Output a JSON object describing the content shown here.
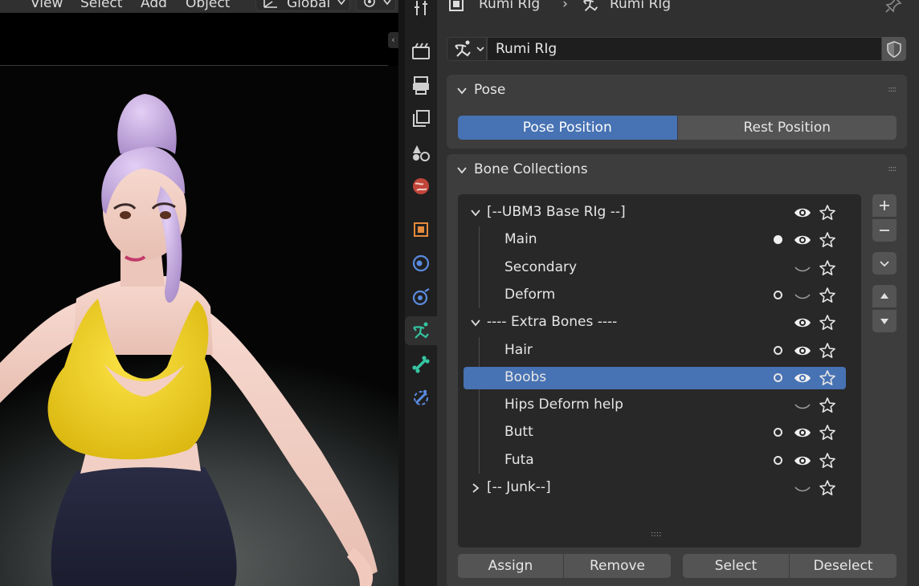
{
  "viewport": {
    "menu": [
      "View",
      "Select",
      "Add",
      "Object"
    ],
    "orientation": "Global"
  },
  "tabs": [
    {
      "icon": "tool-icon"
    },
    {
      "icon": "render-icon"
    },
    {
      "icon": "output-icon"
    },
    {
      "icon": "view-layer-icon"
    },
    {
      "icon": "scene-icon"
    },
    {
      "icon": "world-icon"
    },
    {
      "icon": "object-icon"
    },
    {
      "icon": "modifiers-icon"
    },
    {
      "icon": "physics-icon"
    },
    {
      "icon": "armature-data-icon",
      "active": true
    },
    {
      "icon": "bone-icon"
    },
    {
      "icon": "bone-constraints-icon"
    }
  ],
  "breadcrumb": {
    "object": "Rumi RIg",
    "data": "Rumi RIg"
  },
  "datablock": {
    "name": "Rumi RIg"
  },
  "pose_panel": {
    "title": "Pose",
    "options": [
      "Pose Position",
      "Rest Position"
    ],
    "selected": "Pose Position"
  },
  "bone_collections": {
    "title": "Bone Collections",
    "items": [
      {
        "label": "[--UBM3 Base RIg --]",
        "level": 0,
        "expanded": true,
        "dot": "none",
        "visible": true
      },
      {
        "label": "Main",
        "level": 1,
        "dot": "filled",
        "visible": true
      },
      {
        "label": "Secondary",
        "level": 1,
        "dot": "none",
        "visible": false
      },
      {
        "label": "Deform",
        "level": 1,
        "dot": "ring",
        "visible": false
      },
      {
        "label": "---- Extra Bones ----",
        "level": 0,
        "expanded": true,
        "dot": "none",
        "visible": true
      },
      {
        "label": "Hair",
        "level": 1,
        "dot": "ring",
        "visible": true
      },
      {
        "label": "Boobs",
        "level": 1,
        "dot": "ring",
        "visible": true,
        "selected": true
      },
      {
        "label": "Hips Deform help",
        "level": 1,
        "dot": "none",
        "visible": false
      },
      {
        "label": "Butt",
        "level": 1,
        "dot": "ring",
        "visible": true
      },
      {
        "label": "Futa",
        "level": 1,
        "dot": "ring",
        "visible": true
      },
      {
        "label": "[-- Junk--]",
        "level": 0,
        "expanded": false,
        "dot": "none",
        "visible": false
      }
    ],
    "buttons": {
      "assign": "Assign",
      "remove": "Remove",
      "select": "Select",
      "deselect": "Deselect"
    }
  },
  "colors": {
    "accent": "#4772b3",
    "panel": "#3d3d3d",
    "editor_bg": "#303030",
    "topwear": "#f2d21b",
    "hair": "#c4a6e0"
  }
}
